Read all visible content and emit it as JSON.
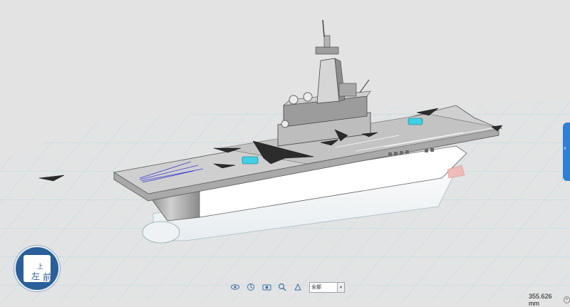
{
  "viewport": {
    "model": "aircraft carrier"
  },
  "view_cube": {
    "top_label": "上",
    "left_label": "左",
    "front_label": "前"
  },
  "toolbar": {
    "icons": [
      "eye-icon",
      "home-view-icon",
      "camera-icon",
      "zoom-fit-icon",
      "search-icon"
    ],
    "view_select_value": "全部"
  },
  "status": {
    "scale": "355.626 mm"
  },
  "colors": {
    "background": "#e3e3e3",
    "grid": "#bfe3ef",
    "accent": "#2f7fd6",
    "deck": "#c8c8c8",
    "hull": "#f4f4f4"
  }
}
